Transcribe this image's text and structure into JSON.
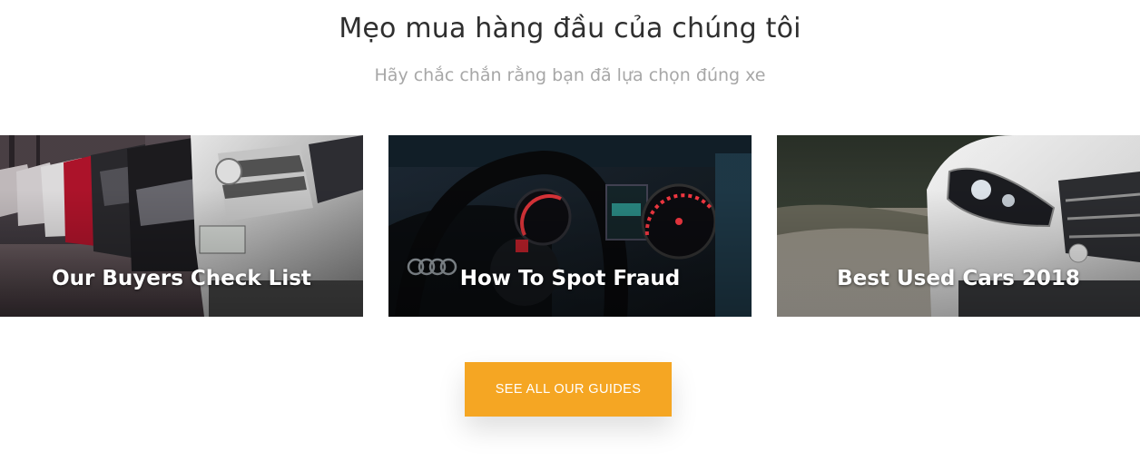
{
  "section": {
    "heading": "Mẹo mua hàng đầu của chúng tôi",
    "subheading": "Hãy chắc chắn rằng bạn đã lựa chọn đúng xe"
  },
  "cards": [
    {
      "title": "Our Buyers Check List"
    },
    {
      "title": "How To Spot Fraud"
    },
    {
      "title": "Best Used Cars 2018"
    }
  ],
  "cta": {
    "label": "SEE ALL OUR GUIDES"
  },
  "colors": {
    "accent": "#f5a623",
    "heading": "#2f2f2f",
    "subheading": "#a7a7a7"
  }
}
